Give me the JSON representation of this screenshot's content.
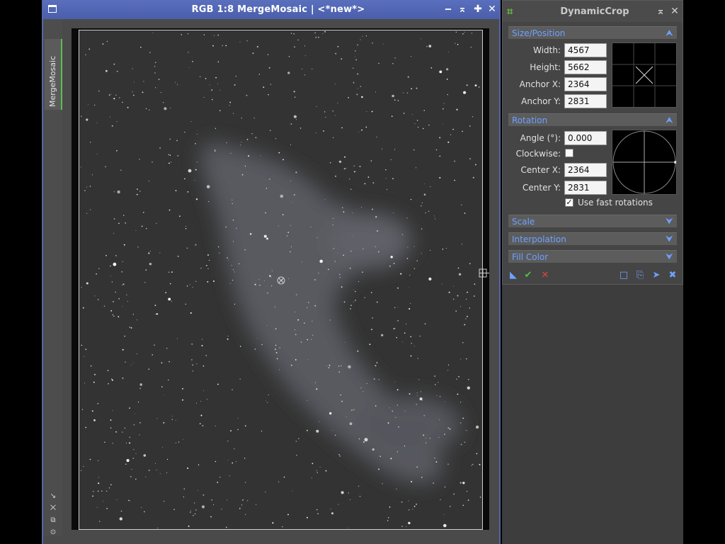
{
  "image_window": {
    "title": "RGB 1:8 MergeMosaic | <*new*>",
    "side_tab_label": "MergeMosaic",
    "buttons": {
      "minimize": "‒",
      "shade": "⌅",
      "maximize": "✚",
      "close": "✕"
    },
    "side_tools": [
      "↘",
      "⨉",
      "⧉",
      "⊙"
    ]
  },
  "dynamic_crop": {
    "title": "DynamicCrop",
    "size_position": {
      "header": "Size/Position",
      "width_label": "Width:",
      "width_value": "4567",
      "height_label": "Height:",
      "height_value": "5662",
      "anchor_x_label": "Anchor X:",
      "anchor_x_value": "2364",
      "anchor_y_label": "Anchor Y:",
      "anchor_y_value": "2831"
    },
    "rotation": {
      "header": "Rotation",
      "angle_label": "Angle (°):",
      "angle_value": "0.000",
      "clockwise_label": "Clockwise:",
      "clockwise_checked": false,
      "center_x_label": "Center X:",
      "center_x_value": "2364",
      "center_y_label": "Center Y:",
      "center_y_value": "2831",
      "fast_rotations_label": "Use fast rotations",
      "fast_rotations_checked": true
    },
    "collapsed_sections": [
      "Scale",
      "Interpolation",
      "Fill Color"
    ],
    "colors": {
      "accent_blue": "#6fa0ff",
      "apply_green": "#4fc04f",
      "cancel_red": "#e0453a"
    }
  }
}
